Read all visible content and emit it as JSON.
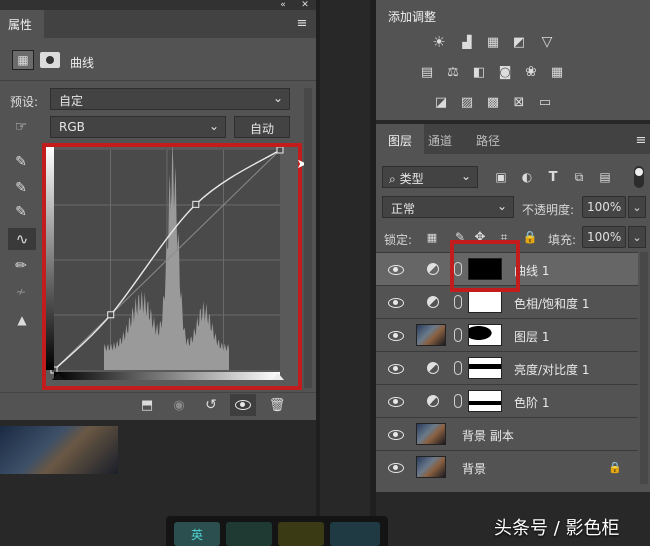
{
  "properties_panel": {
    "tab_label": "属性",
    "adjustment_name": "曲线",
    "preset_label": "预设:",
    "preset_value": "自定",
    "channel_value": "RGB",
    "auto_button": "自动"
  },
  "adjustments_panel": {
    "title": "添加调整"
  },
  "layers_panel": {
    "tabs": [
      "图层",
      "通道",
      "路径"
    ],
    "filter_kind": "类型",
    "blend_mode": "正常",
    "opacity_label": "不透明度:",
    "opacity_value": "100%",
    "lock_label": "锁定:",
    "fill_label": "填充:",
    "fill_value": "100%",
    "layers": [
      {
        "name": "曲线 1",
        "type": "adjustment",
        "mask": "black",
        "active": true
      },
      {
        "name": "色相/饱和度 1",
        "type": "adjustment",
        "mask": "white",
        "active": false
      },
      {
        "name": "图层 1",
        "type": "image",
        "mask": "shape",
        "active": false
      },
      {
        "name": "亮度/对比度 1",
        "type": "adjustment",
        "mask": "shape2",
        "active": false
      },
      {
        "name": "色阶 1",
        "type": "adjustment",
        "mask": "shape3",
        "active": false
      },
      {
        "name": "背景 副本",
        "type": "image",
        "mask": "",
        "active": false
      },
      {
        "name": "背景",
        "type": "image",
        "mask": "",
        "active": false,
        "locked": true
      }
    ]
  },
  "watermark": "头条号 / 影色柜",
  "dock_item": "英",
  "chart_data": {
    "type": "line",
    "curve_points": [
      [
        0,
        0
      ],
      [
        64,
        64
      ],
      [
        160,
        192
      ],
      [
        255,
        255
      ]
    ],
    "xlim": [
      0,
      255
    ],
    "ylim": [
      0,
      255
    ]
  },
  "colors": {
    "highlight_red": "#c21c1c",
    "panel_bg": "#535353"
  }
}
